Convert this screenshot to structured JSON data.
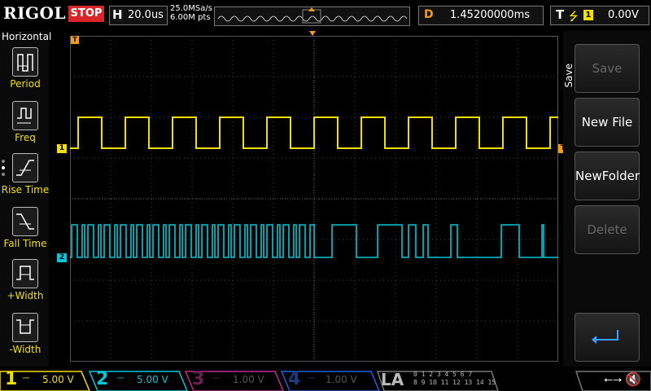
{
  "header": {
    "brand": "RIGOL",
    "run_state": "STOP",
    "timebase_label": "H",
    "timebase_value": "20.0us",
    "sample_rate": "25.0MSa/s",
    "memory_depth": "6.00M pts",
    "delay_label": "D",
    "delay_value": "1.45200000ms",
    "trigger_label": "T",
    "trigger_source": "1",
    "trigger_level": "0.00V"
  },
  "measure_panel": {
    "title": "Horizontal",
    "items": [
      {
        "label": "Period",
        "icon": "period-icon"
      },
      {
        "label": "Freq",
        "icon": "freq-icon"
      },
      {
        "label": "Rise Time",
        "icon": "rise-time-icon"
      },
      {
        "label": "Fall Time",
        "icon": "fall-time-icon"
      },
      {
        "label": "+Width",
        "icon": "positive-width-icon"
      },
      {
        "label": "-Width",
        "icon": "negative-width-icon"
      }
    ]
  },
  "save_menu": {
    "title": "Save",
    "buttons": [
      {
        "label": "Save",
        "enabled": false
      },
      {
        "label": "New File",
        "enabled": true
      },
      {
        "label": "NewFolder",
        "enabled": true
      },
      {
        "label": "Delete",
        "enabled": false
      },
      {
        "label": "",
        "enabled": true,
        "icon": "return-icon"
      }
    ]
  },
  "markers": {
    "ch1": "1",
    "ch2": "2",
    "trigger_pos": "T"
  },
  "channels": [
    {
      "num": "1",
      "scale": "5.00 V",
      "color": "#f0e000",
      "active": true
    },
    {
      "num": "2",
      "scale": "5.00 V",
      "color": "#00c8d8",
      "active": true
    },
    {
      "num": "3",
      "scale": "1.00 V",
      "color": "#c02890",
      "active": false
    },
    {
      "num": "4",
      "scale": "1.00 V",
      "color": "#2060e0",
      "active": false
    }
  ],
  "la": {
    "label": "LA",
    "bits_row1": "0 1 2 3  4 5 6 7",
    "bits_row2": "8 9 10 11  12 13 14 15"
  },
  "colors": {
    "ch1": "#f0e000",
    "ch2": "#00c8d8",
    "trigger": "#f39c1a",
    "stop": "#d9262b"
  }
}
